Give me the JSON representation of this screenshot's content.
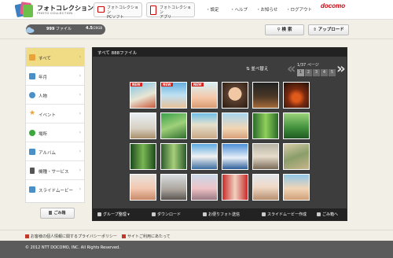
{
  "header": {
    "logo_title": "フォトコレクション",
    "logo_sub": "PHOTO COLLECTION",
    "app_links": [
      {
        "line1": "フォトコレクション",
        "line2": "PCソフト"
      },
      {
        "line1": "フォトコレクション",
        "line2": "アプリ"
      }
    ],
    "nav": [
      "設定",
      "ヘルプ",
      "お知らせ",
      "ログアウト"
    ],
    "brand": "docomo"
  },
  "status": {
    "file_count": "999",
    "file_unit": "ファイル",
    "size": "4.5",
    "size_unit": "/20GB",
    "search_label": "検 索",
    "upload_label": "アップロード"
  },
  "sidebar": {
    "items": [
      {
        "label": "すべて",
        "icon": "folder-icon",
        "color": "#e8a43a"
      },
      {
        "label": "年月",
        "icon": "calendar-icon",
        "color": "#4a90c8"
      },
      {
        "label": "人物",
        "icon": "person-icon",
        "color": "#4a90c8"
      },
      {
        "label": "イベント",
        "icon": "star-icon",
        "color": "#e8a43a"
      },
      {
        "label": "場所",
        "icon": "globe-icon",
        "color": "#3aa83a"
      },
      {
        "label": "アルバム",
        "icon": "album-icon",
        "color": "#4a90c8"
      },
      {
        "label": "機種・サービス",
        "icon": "phone-icon",
        "color": "#555555"
      },
      {
        "label": "スライドムービー",
        "icon": "film-icon",
        "color": "#4a90c8"
      }
    ],
    "trash_label": "ごみ箱"
  },
  "main": {
    "heading": "すべて  888ファイル",
    "sort_label": "並べ替え",
    "page_info": "1/37 ページ",
    "pages": [
      "1",
      "2",
      "3",
      "4",
      "5"
    ],
    "new_badge": "NEW",
    "bottom_actions": [
      "グループ整理",
      "ダウンロード",
      "お便りフォト送信",
      "スライドムービー作成",
      "ごみ箱へ"
    ]
  },
  "footer": {
    "links": [
      "お客様の個人情報に関するプライバシーポリシー",
      "サイトご利用にあたって"
    ],
    "copyright": "© 2012 NTT DOCOMO, INC. All Rights Reserved."
  },
  "colors": {
    "accent": "#c8000a",
    "active_tab": "#f0dc84",
    "panel": "#3d3d3d"
  }
}
